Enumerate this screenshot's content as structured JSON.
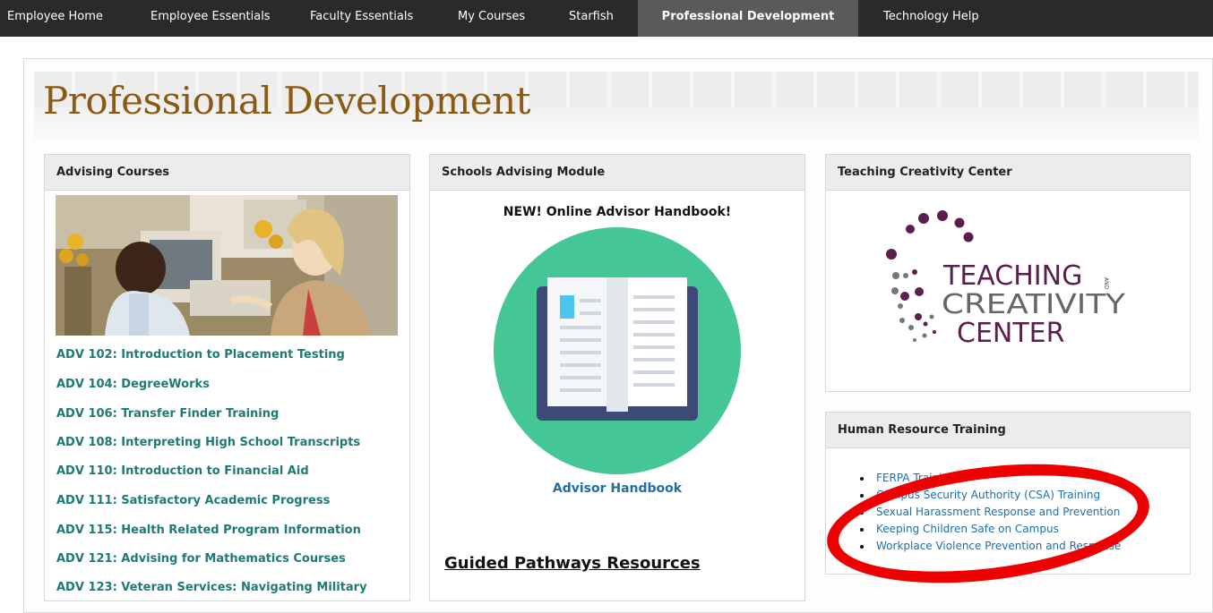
{
  "nav": {
    "items": [
      {
        "label": "Employee Home"
      },
      {
        "label": "Employee Essentials"
      },
      {
        "label": "Faculty Essentials"
      },
      {
        "label": "My Courses"
      },
      {
        "label": "Starfish"
      },
      {
        "label": "Professional Development",
        "active": true
      },
      {
        "label": "Technology Help"
      }
    ]
  },
  "page": {
    "title": "Professional Development"
  },
  "advising": {
    "title": "Advising Courses",
    "links": [
      "ADV 102: Introduction to Placement Testing",
      "ADV 104: DegreeWorks",
      "ADV 106: Transfer Finder Training",
      "ADV 108: Interpreting High School Transcripts",
      "ADV 110: Introduction to Financial Aid",
      "ADV 111: Satisfactory Academic Progress",
      "ADV 115: Health Related Program Information",
      "ADV 121: Advising for Mathematics Courses",
      "ADV 123: Veteran Services: Navigating Military"
    ]
  },
  "schools": {
    "title": "Schools Advising Module",
    "heading": "NEW! Online Advisor Handbook!",
    "link": "Advisor Handbook",
    "pathways": "Guided Pathways Resources"
  },
  "teaching": {
    "title": "Teaching Creativity Center",
    "logo_line1": "TEACHING",
    "logo_and": "AND",
    "logo_line2": "CREATIVITY",
    "logo_line3": "CENTER"
  },
  "hr": {
    "title": "Human Resource Training",
    "links": [
      "FERPA Training",
      "Campus Security Authority (CSA) Training",
      "Sexual Harassment Response and Prevention",
      "Keeping Children Safe on Campus",
      "Workplace Violence Prevention and Response"
    ]
  },
  "colors": {
    "nav_bg": "#2a2a2a",
    "title_brown": "#8b5a12",
    "link_teal": "#1e7a74",
    "link_blue": "#1e6ea8",
    "book_green": "#45c795",
    "logo_purple": "#5a1f4e",
    "annotation_red": "#ee0000"
  }
}
